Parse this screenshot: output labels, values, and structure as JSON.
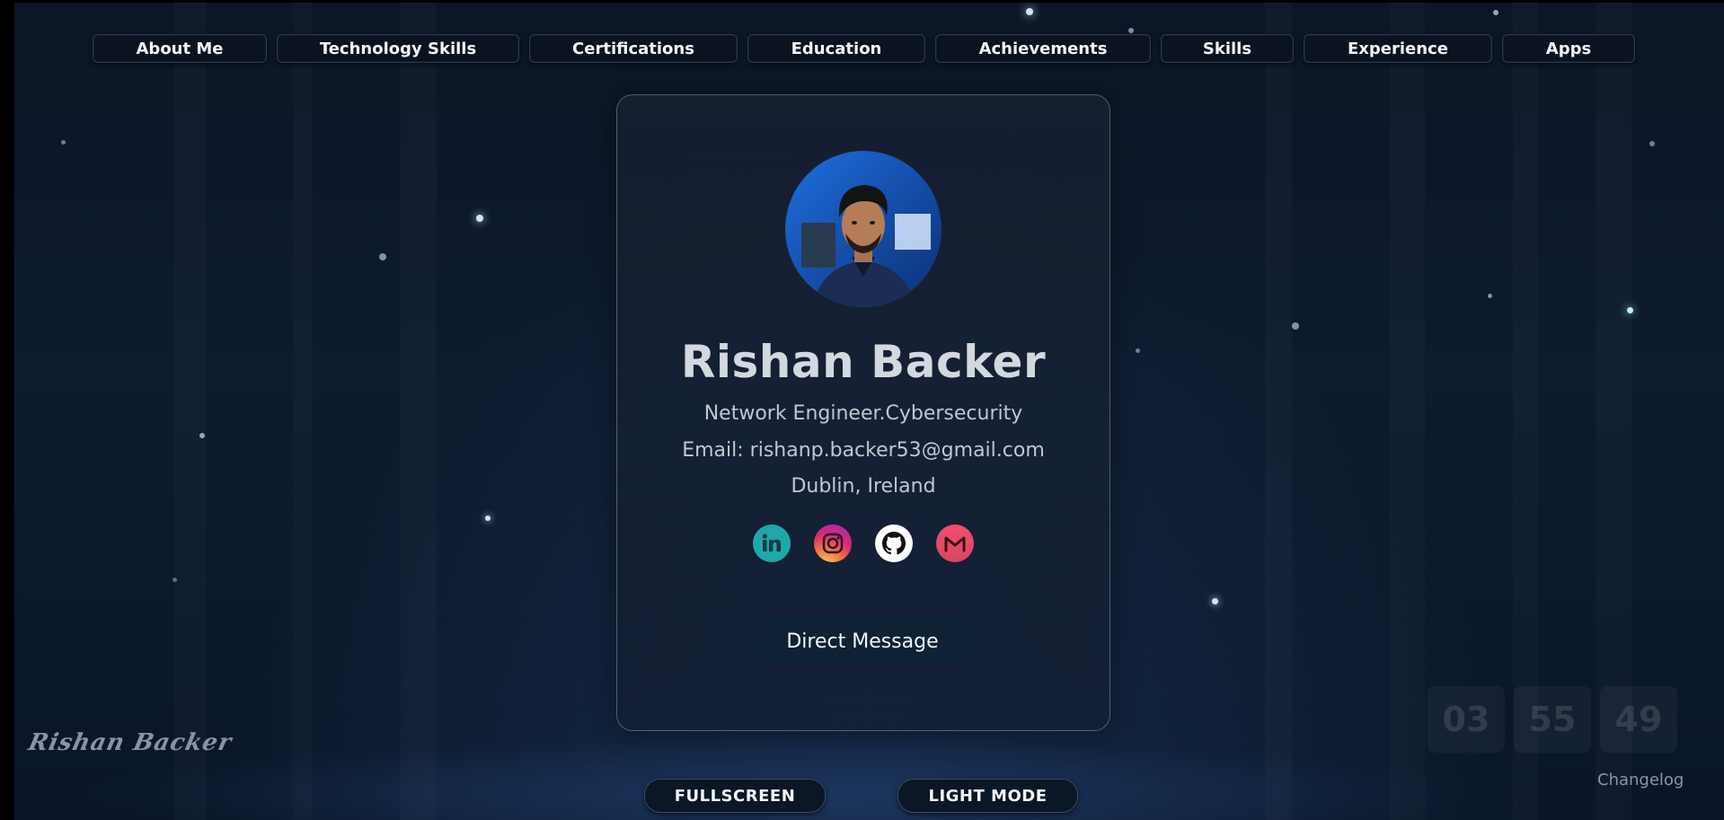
{
  "nav": {
    "items": [
      {
        "label": "About Me"
      },
      {
        "label": "Technology Skills"
      },
      {
        "label": "Certifications"
      },
      {
        "label": "Education"
      },
      {
        "label": "Achievements"
      },
      {
        "label": "Skills"
      },
      {
        "label": "Experience"
      },
      {
        "label": "Apps"
      }
    ]
  },
  "profile": {
    "name": "Rishan Backer",
    "title": "Network Engineer.Cybersecurity",
    "email": "Email: rishanp.backer53@gmail.com",
    "location": "Dublin, Ireland",
    "socials": [
      {
        "icon": "linkedin-icon"
      },
      {
        "icon": "instagram-icon"
      },
      {
        "icon": "github-icon"
      },
      {
        "icon": "gmail-icon"
      }
    ],
    "cta_label": "Direct Message"
  },
  "controls": {
    "fullscreen_label": "FULLSCREEN",
    "light_mode_label": "LIGHT MODE"
  },
  "signature": "Rishan Backer",
  "clock": {
    "hours": "03",
    "minutes": "55",
    "seconds": "49"
  },
  "changelog_label": "Changelog",
  "colors": {
    "background": "#0d1b2e",
    "accent_button": "#0e2135",
    "text_primary": "#f4f6fa"
  }
}
